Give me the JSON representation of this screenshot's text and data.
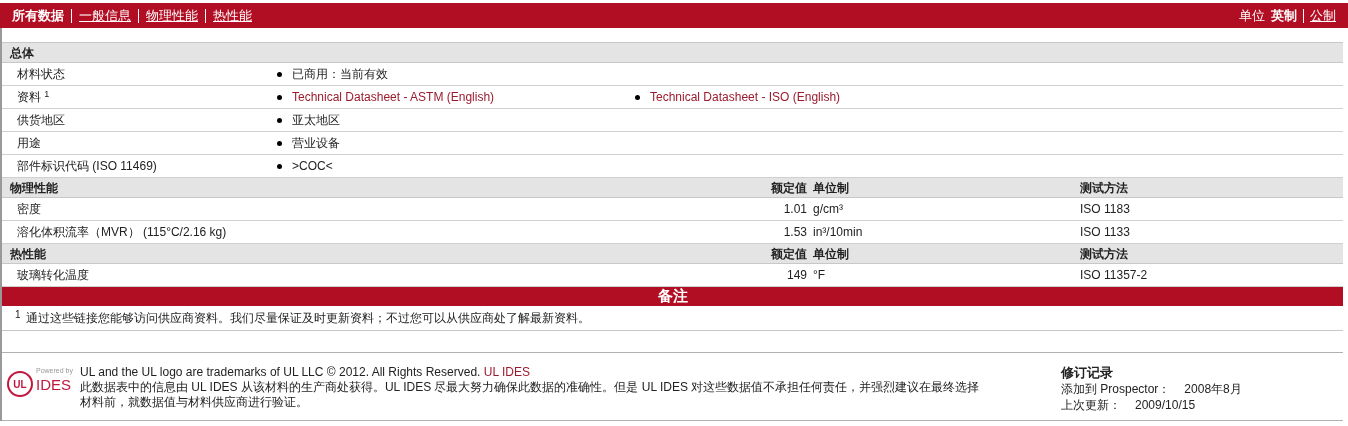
{
  "nav": {
    "tabs": [
      {
        "label": "所有数据",
        "selected": true
      },
      {
        "label": "一般信息",
        "selected": false
      },
      {
        "label": "物理性能",
        "selected": false
      },
      {
        "label": "热性能",
        "selected": false
      }
    ],
    "units_label": "单位",
    "units": [
      {
        "label": "英制",
        "selected": true
      },
      {
        "label": "公制",
        "selected": false
      }
    ]
  },
  "sections": [
    {
      "kind": "general",
      "title": "总体",
      "rows": [
        {
          "label": "材料状态",
          "values": [
            {
              "kind": "text",
              "text": "已商用：当前有效"
            }
          ]
        },
        {
          "label": "资料 $^{1}$",
          "values": [
            {
              "kind": "link",
              "text": "Technical Datasheet - ASTM (English)"
            },
            {
              "kind": "link",
              "text": "Technical Datasheet - ISO (English)"
            }
          ]
        },
        {
          "label": "供货地区",
          "values": [
            {
              "kind": "text",
              "text": "亚太地区"
            }
          ]
        },
        {
          "label": "用途",
          "values": [
            {
              "kind": "text",
              "text": "营业设备"
            }
          ]
        },
        {
          "label": "部件标识代码  (ISO 11469)",
          "values": [
            {
              "kind": "text",
              "text": ">COC<"
            }
          ]
        }
      ]
    },
    {
      "kind": "property",
      "title": "物理性能",
      "columns": [
        "额定值",
        "单位制",
        "测试方法"
      ],
      "rows": [
        {
          "label": "密度",
          "value": "1.01",
          "unit": "g/cm³",
          "method": "ISO 1183"
        },
        {
          "label": "溶化体积流率（MVR）  (115°C/2.16 kg)",
          "value": "1.53",
          "unit": "in³/10min",
          "method": "ISO 1133"
        }
      ]
    },
    {
      "kind": "property",
      "title": "热性能",
      "columns": [
        "额定值",
        "单位制",
        "测试方法"
      ],
      "rows": [
        {
          "label": "玻璃转化温度",
          "value": "149",
          "unit": "°F",
          "method": "ISO 11357-2"
        }
      ]
    }
  ],
  "notes": {
    "title": "备注",
    "items": [
      {
        "mark": "1",
        "text": "通过这些链接您能够访问供应商资料。我们尽量保证及时更新资料；不过您可以从供应商处了解最新资料。"
      }
    ]
  },
  "footer": {
    "logo": {
      "mark": "UL",
      "powered_by": "Powered by",
      "brand": "IDES"
    },
    "trademark": "UL and the UL logo are trademarks of UL LLC © 2012. All Rights Reserved.",
    "trademark_link": "UL IDES",
    "disclaimer": "此数据表中的信息由  UL IDES 从该材料的生产商处获得。UL IDES 尽最大努力确保此数据的准确性。但是  UL IDES 对这些数据值不承担任何责任，并强烈建议在最终选择材料前，就数据值与材料供应商进行验证。",
    "revision": {
      "title": "修订记录",
      "added_label": "添加到  Prospector：",
      "added_value": "2008年8月",
      "updated_label": "上次更新：",
      "updated_value": "2009/10/15"
    }
  }
}
